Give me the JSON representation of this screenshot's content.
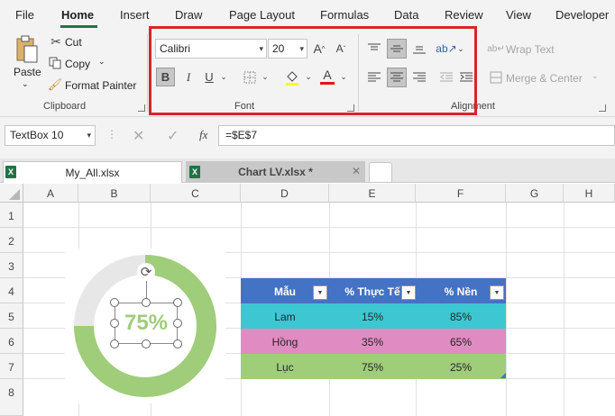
{
  "menu": {
    "tabs": [
      {
        "label": "File",
        "key": "file"
      },
      {
        "label": "Home",
        "key": "home"
      },
      {
        "label": "Insert",
        "key": "insert"
      },
      {
        "label": "Draw",
        "key": "draw"
      },
      {
        "label": "Page Layout",
        "key": "page-layout"
      },
      {
        "label": "Formulas",
        "key": "formulas"
      },
      {
        "label": "Data",
        "key": "data"
      },
      {
        "label": "Review",
        "key": "review"
      },
      {
        "label": "View",
        "key": "view"
      },
      {
        "label": "Developer",
        "key": "developer"
      }
    ],
    "active": "Home"
  },
  "ribbon": {
    "clipboard": {
      "paste_label": "Paste",
      "cut_label": "Cut",
      "copy_label": "Copy",
      "format_painter_label": "Format Painter",
      "group_label": "Clipboard"
    },
    "font": {
      "font_name": "Calibri",
      "font_size": "20",
      "group_label": "Font"
    },
    "alignment": {
      "wrap_text_label": "Wrap Text",
      "merge_center_label": "Merge & Center",
      "group_label": "Alignment"
    }
  },
  "formula_bar": {
    "name_box": "TextBox 10",
    "fx_label": "fx",
    "formula": "=$E$7"
  },
  "workbooks": [
    {
      "name": "My_All.xlsx",
      "active": false
    },
    {
      "name": "Chart LV.xlsx *",
      "active": true
    }
  ],
  "sheet": {
    "columns": [
      "A",
      "B",
      "C",
      "D",
      "E",
      "F",
      "G",
      "H"
    ],
    "rows": [
      "1",
      "2",
      "3",
      "4",
      "5",
      "6",
      "7",
      "8"
    ]
  },
  "donut": {
    "label": "75%",
    "value_percent": 75,
    "fill_color": "#9fcd7a",
    "track_color": "#e7e7e7"
  },
  "table": {
    "headers": [
      "Mẫu",
      "% Thực Tế",
      "% Nền"
    ],
    "rows": [
      {
        "name": "Lam",
        "actual": "15%",
        "base": "85%",
        "color": "#3dc7d3"
      },
      {
        "name": "Hồng",
        "actual": "35%",
        "base": "65%",
        "color": "#e08bc1"
      },
      {
        "name": "Lục",
        "actual": "75%",
        "base": "25%",
        "color": "#9fcd7a"
      }
    ],
    "header_color": "#4472c4"
  }
}
